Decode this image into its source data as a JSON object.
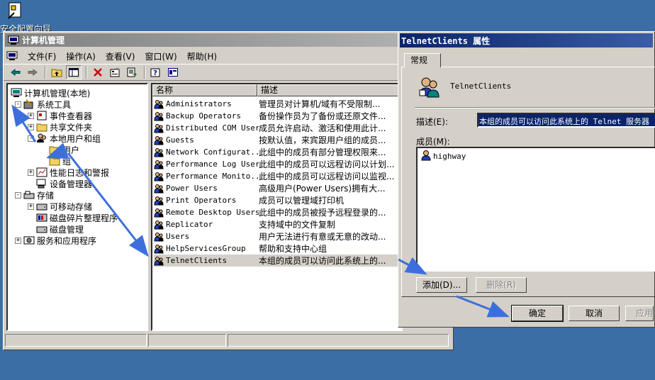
{
  "desktop": {
    "icon_label": "安全配置向导"
  },
  "main_window": {
    "title": "计算机管理",
    "menu": [
      {
        "label": "文件(F)"
      },
      {
        "label": "操作(A)"
      },
      {
        "label": "查看(V)"
      },
      {
        "label": "窗口(W)"
      },
      {
        "label": "帮助(H)"
      }
    ],
    "tree": [
      {
        "label": "计算机管理(本地)",
        "level": 0,
        "exp": ""
      },
      {
        "label": "系统工具",
        "level": 1,
        "exp": "-"
      },
      {
        "label": "事件查看器",
        "level": 2,
        "exp": "+"
      },
      {
        "label": "共享文件夹",
        "level": 2,
        "exp": "+"
      },
      {
        "label": "本地用户和组",
        "level": 2,
        "exp": "-"
      },
      {
        "label": "用户",
        "level": 3,
        "exp": ""
      },
      {
        "label": "组",
        "level": 3,
        "exp": ""
      },
      {
        "label": "性能日志和警报",
        "level": 2,
        "exp": "+"
      },
      {
        "label": "设备管理器",
        "level": 2,
        "exp": ""
      },
      {
        "label": "存储",
        "level": 1,
        "exp": "-"
      },
      {
        "label": "可移动存储",
        "level": 2,
        "exp": "+"
      },
      {
        "label": "磁盘碎片整理程序",
        "level": 2,
        "exp": ""
      },
      {
        "label": "磁盘管理",
        "level": 2,
        "exp": ""
      },
      {
        "label": "服务和应用程序",
        "level": 1,
        "exp": "+"
      }
    ],
    "list_headers": {
      "name": "名称",
      "desc": "描述"
    },
    "groups": [
      {
        "name": "Administrators",
        "desc": "管理员对计算机/域有不受限制..."
      },
      {
        "name": "Backup Operators",
        "desc": "备份操作员为了备份或还原文件..."
      },
      {
        "name": "Distributed COM Users",
        "desc": "成员允许启动、激活和使用此计..."
      },
      {
        "name": "Guests",
        "desc": "按默认值，来宾跟用户组的成员..."
      },
      {
        "name": "Network Configurat...",
        "desc": "此组中的成员有部分管理权限来..."
      },
      {
        "name": "Performance Log Users",
        "desc": "此组中的成员可以远程访问以计划..."
      },
      {
        "name": "Performance Monito...",
        "desc": "此组中的成员可以远程访问以监视..."
      },
      {
        "name": "Power Users",
        "desc": "高级用户(Power Users)拥有大..."
      },
      {
        "name": "Print Operators",
        "desc": "成员可以管理域打印机"
      },
      {
        "name": "Remote Desktop Users",
        "desc": "此组中的成员被授予远程登录的..."
      },
      {
        "name": "Replicator",
        "desc": "支持域中的文件复制"
      },
      {
        "name": "Users",
        "desc": "用户无法进行有意或无意的改动..."
      },
      {
        "name": "HelpServicesGroup",
        "desc": "帮助和支持中心组"
      },
      {
        "name": "TelnetClients",
        "desc": "本组的成员可以访问此系统上的..."
      }
    ]
  },
  "dialog": {
    "title": "TelnetClients 属性",
    "tab": "常规",
    "group_name": "TelnetClients",
    "desc_label": "描述(E):",
    "desc_value": "本组的成员可以访问此系统上的 Telnet 服务器",
    "members_label": "成员(M):",
    "members": [
      "highway"
    ],
    "add_button": "添加(D)...",
    "remove_button": "删除(R)",
    "ok_button": "确定",
    "cancel_button": "取消",
    "apply_button": "应用"
  },
  "colors": {
    "desktop": "#3a6ea5",
    "annotation_arrow": "#3d6fdc",
    "active_title": "#0a246a"
  }
}
